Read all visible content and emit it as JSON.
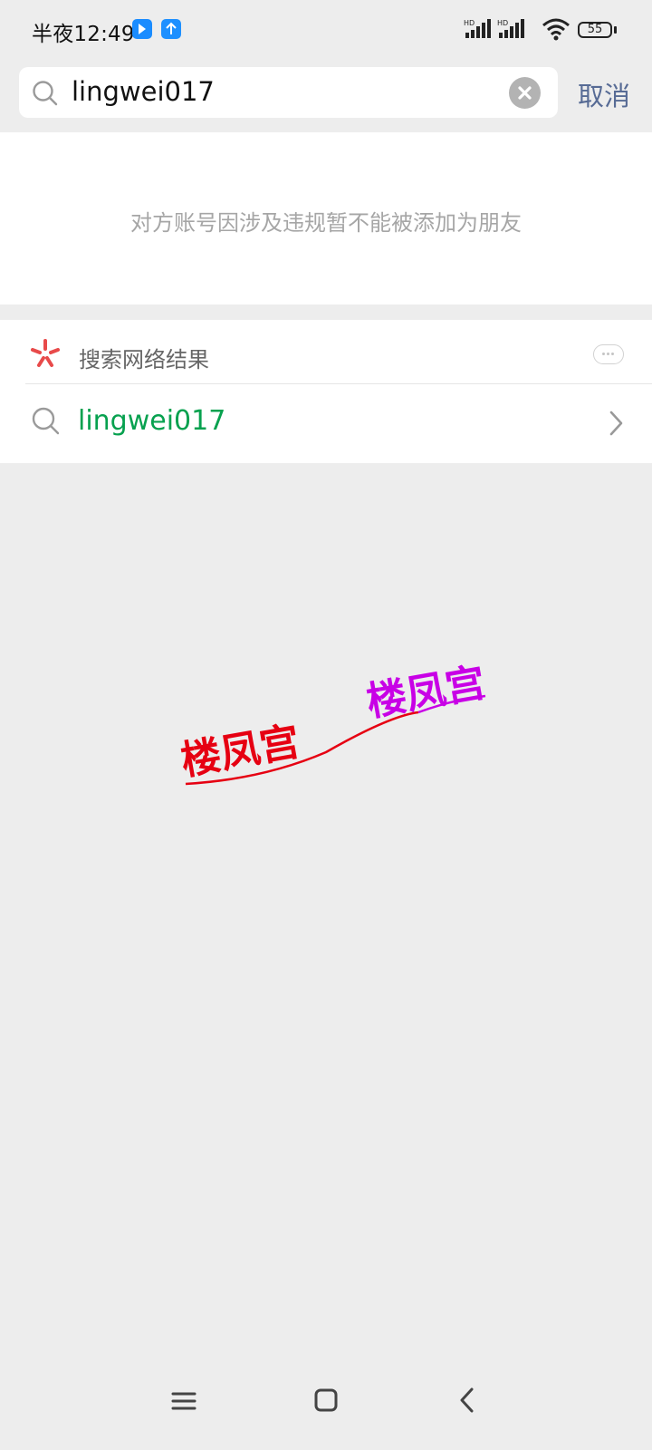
{
  "status_bar": {
    "time": "半夜12:49",
    "battery": "55",
    "net_label": "HD"
  },
  "search": {
    "query": "lingwei017",
    "cancel_label": "取消"
  },
  "notice": {
    "text": "对方账号因涉及违规暂不能被添加为朋友"
  },
  "network_results": {
    "header_label": "搜索网络结果",
    "item_text": "lingwei017"
  },
  "watermark": {
    "text_1": "楼凤宫",
    "text_2": "楼凤宫",
    "color_1": "#e60012",
    "color_2": "#c800e6"
  },
  "colors": {
    "accent_link": "#576b95",
    "result_green": "#07a14f",
    "background": "#ededed"
  }
}
